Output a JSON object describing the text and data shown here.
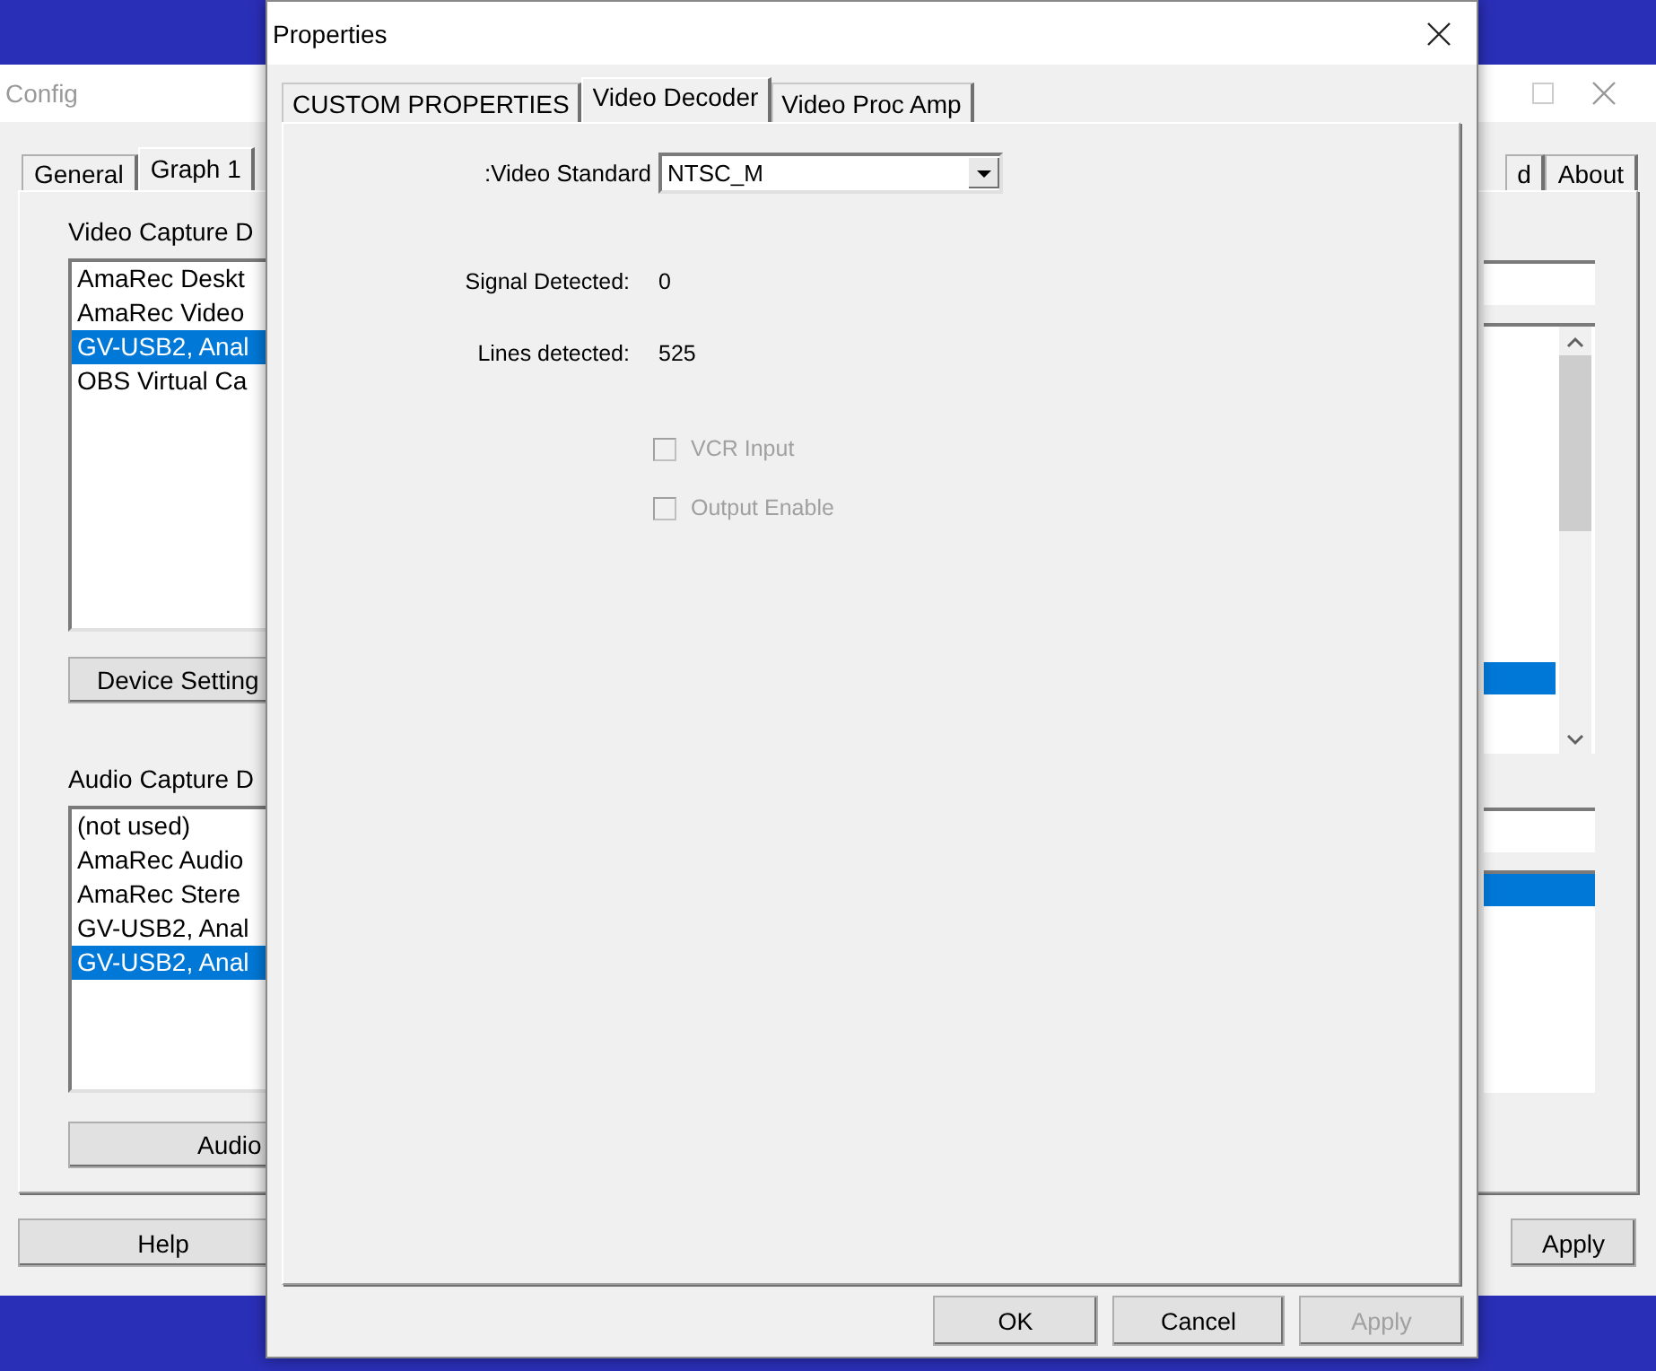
{
  "config_window": {
    "title": "Config",
    "tabs_left": [
      {
        "label": "General",
        "selected": false
      },
      {
        "label": "Graph 1",
        "selected": true
      }
    ],
    "tabs_right": [
      {
        "label": "d",
        "selected": false
      },
      {
        "label": "About",
        "selected": false
      }
    ],
    "video_capture": {
      "label": "Video Capture D",
      "devices": [
        {
          "label": "AmaRec Deskt",
          "selected": false
        },
        {
          "label": "AmaRec Video",
          "selected": false
        },
        {
          "label": "GV-USB2, Anal",
          "selected": true
        },
        {
          "label": "OBS Virtual Ca",
          "selected": false
        }
      ],
      "button": "Device Setting"
    },
    "audio_capture": {
      "label": "Audio Capture D",
      "devices": [
        {
          "label": "(not used)",
          "selected": false
        },
        {
          "label": "AmaRec Audio",
          "selected": false
        },
        {
          "label": "AmaRec Stere",
          "selected": false
        },
        {
          "label": "GV-USB2, Anal",
          "selected": false
        },
        {
          "label": "GV-USB2, Anal",
          "selected": true
        }
      ],
      "button": "Audio"
    },
    "buttons": [
      "Help",
      "Apply"
    ]
  },
  "properties_dialog": {
    "title": "Properties",
    "tabs": [
      {
        "label": "CUSTOM PROPERTIES",
        "selected": false
      },
      {
        "label": "Video Decoder",
        "selected": true
      },
      {
        "label": "Video Proc Amp",
        "selected": false
      }
    ],
    "video_standard": {
      "label": ":Video Standard",
      "value": "NTSC_M"
    },
    "readings": [
      {
        "label": "Signal Detected:",
        "value": "0"
      },
      {
        "label": "Lines detected:",
        "value": "525"
      }
    ],
    "checkboxes": [
      {
        "label": "VCR Input",
        "checked": false,
        "disabled": true
      },
      {
        "label": "Output Enable",
        "checked": false,
        "disabled": true
      }
    ],
    "buttons": [
      {
        "label": "OK",
        "disabled": false
      },
      {
        "label": "Cancel",
        "disabled": false
      },
      {
        "label": "Apply",
        "disabled": true
      }
    ]
  }
}
